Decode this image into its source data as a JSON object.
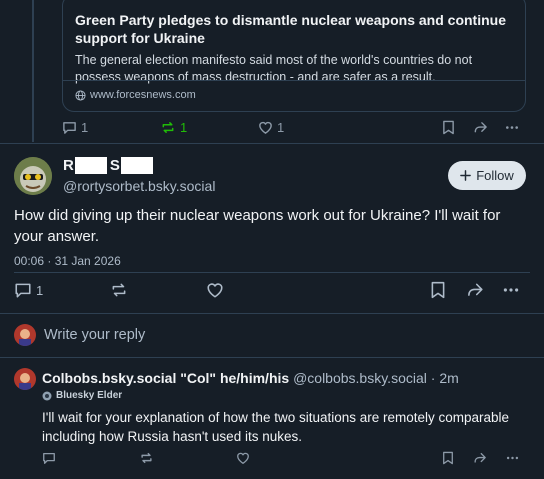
{
  "quoted_card": {
    "title": "Green Party pledges to dismantle nuclear weapons and continue support for Ukraine",
    "description": "The general election manifesto said most of the world's countries do not possess weapons of mass destruction - and are safer as a result.",
    "source": "www.forcesnews.com"
  },
  "parent_actions": {
    "reply_count": "1",
    "repost_count": "1",
    "like_count": "1"
  },
  "post": {
    "display_name_visible_1": "R",
    "display_name_visible_2": "S",
    "handle": "@rortysorbet.bsky.social",
    "follow_label": "Follow",
    "text": "How did giving up their nuclear weapons work out for Ukraine?  I'll wait for your answer.",
    "timestamp": "00:06 · 31 Jan 2026",
    "reply_count": "1"
  },
  "compose": {
    "placeholder": "Write your reply"
  },
  "reply": {
    "display_name": "Colbobs.bsky.social \"Col\" he/him/his",
    "handle": "@colbobs.bsky.social",
    "age": "· 2m",
    "badge": "Bluesky Elder",
    "text": "I'll wait for your explanation of how the two situations are remotely comparable including how Russia hasn't used its nukes."
  },
  "colors": {
    "background": "#161e27",
    "border": "#2e4052",
    "repost_active": "#20bc07",
    "text_primary": "#f1f3f5",
    "text_secondary": "#aebbc9"
  },
  "icons": [
    "reply-icon",
    "repost-icon",
    "like-icon",
    "bookmark-icon",
    "share-icon",
    "more-icon",
    "globe-icon",
    "plus-icon",
    "badge-icon"
  ]
}
